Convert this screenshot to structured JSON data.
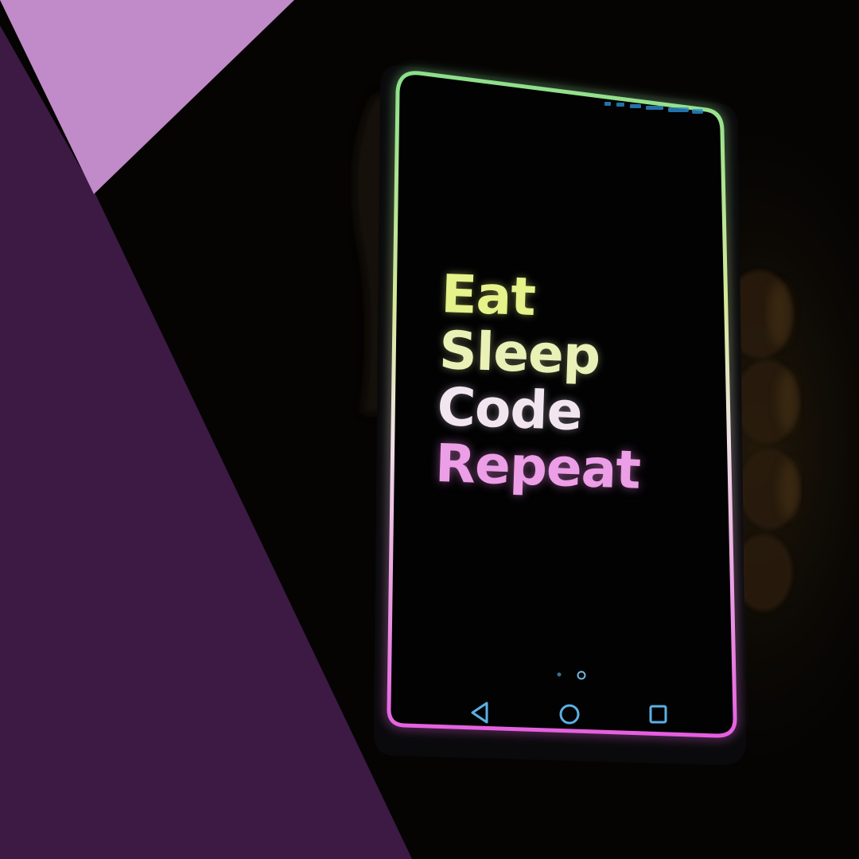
{
  "phone": {
    "screen_lines": [
      "Eat",
      "Sleep",
      "Code",
      "Repeat"
    ]
  },
  "colors": {
    "dark_purple": "#3c1a44",
    "light_purple": "#c18ac9",
    "frame_top": "#8be08a",
    "frame_mid": "#e8e3b5",
    "frame_bottom": "#e65ee0",
    "nav_icons": "#5ab0e6"
  },
  "icons": [
    "nav-back-icon",
    "nav-home-icon",
    "nav-recents-icon",
    "page-indicator-dots"
  ]
}
